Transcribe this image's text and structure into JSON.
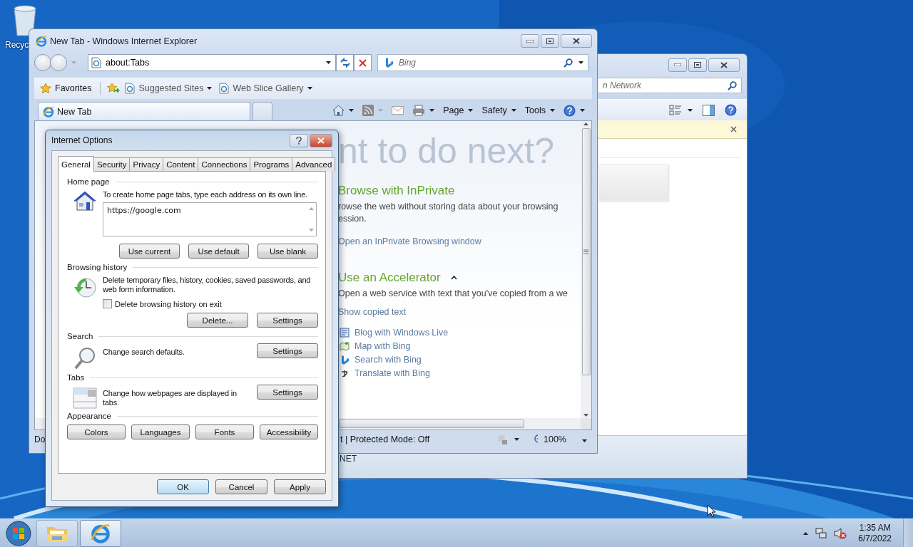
{
  "desktop": {
    "icons": [
      {
        "label": "Recyc"
      }
    ]
  },
  "back_window": {
    "search": {
      "placeholder": "n Network"
    },
    "details": {
      "text": "NET"
    }
  },
  "browser": {
    "title": "New Tab - Windows Internet Explorer",
    "address": "about:Tabs",
    "search": {
      "placeholder": "Bing"
    },
    "favorites_bar": [
      {
        "kind": "favorites",
        "label": "Favorites"
      },
      {
        "kind": "add"
      },
      {
        "kind": "menu",
        "label": "Suggested Sites"
      },
      {
        "kind": "menu",
        "label": "Web Slice Gallery"
      }
    ],
    "tabs": [
      {
        "label": "New Tab",
        "selected": true
      }
    ],
    "command_menus": [
      "Page",
      "Safety",
      "Tools"
    ],
    "page": {
      "headline": "nt to do next?",
      "sections": [
        {
          "title": "Browse with InPrivate",
          "text": "rowse the web without storing data about your browsing ession.",
          "link": "Open an InPrivate Browsing window"
        },
        {
          "title": "Use an Accelerator",
          "expanded": true,
          "text": "Open a web service with text that you've copied from a we",
          "link": "Show copied text",
          "items": [
            {
              "kind": "blog",
              "label": "Blog with Windows Live"
            },
            {
              "kind": "map",
              "label": "Map with Bing"
            },
            {
              "kind": "search",
              "label": "Search with Bing"
            },
            {
              "kind": "translate",
              "label": "Translate with Bing"
            }
          ]
        }
      ]
    },
    "status_bar": {
      "left": "Do",
      "zone": "t | Protected Mode: Off",
      "zoom": "100%"
    }
  },
  "dialog": {
    "title": "Internet Options",
    "tabs": [
      {
        "label": "General",
        "selected": true
      },
      {
        "label": "Security",
        "selected": false
      },
      {
        "label": "Privacy",
        "selected": false
      },
      {
        "label": "Content",
        "selected": false
      },
      {
        "label": "Connections",
        "selected": false
      },
      {
        "label": "Programs",
        "selected": false
      },
      {
        "label": "Advanced",
        "selected": false
      }
    ],
    "sections": [
      {
        "kind": "home",
        "heading": "Home page",
        "text": "To create home page tabs, type each address on its own line.",
        "value": "https://google.com",
        "buttons": [
          "Use current",
          "Use default",
          "Use blank"
        ]
      },
      {
        "kind": "history",
        "heading": "Browsing history",
        "text": "Delete temporary files, history, cookies, saved passwords, and web form information.",
        "checkbox": {
          "label": "Delete browsing history on exit",
          "checked": false
        },
        "buttons": [
          "Delete...",
          "Settings"
        ]
      },
      {
        "kind": "search",
        "heading": "Search",
        "text": "Change search defaults.",
        "buttons": [
          "Settings"
        ]
      },
      {
        "kind": "tabs",
        "heading": "Tabs",
        "text": "Change how webpages are displayed in tabs.",
        "buttons": [
          "Settings"
        ]
      },
      {
        "kind": "appearance",
        "heading": "Appearance",
        "buttons": [
          "Colors",
          "Languages",
          "Fonts",
          "Accessibility"
        ]
      }
    ],
    "footer": [
      {
        "label": "OK",
        "default": true
      },
      {
        "label": "Cancel",
        "default": false
      },
      {
        "label": "Apply",
        "default": false
      }
    ]
  },
  "taskbar": {
    "items": [
      {
        "kind": "explorer",
        "active": false
      },
      {
        "kind": "browser",
        "active": true
      }
    ],
    "clock": {
      "time": "1:35 AM",
      "date": "6/7/2022"
    }
  }
}
